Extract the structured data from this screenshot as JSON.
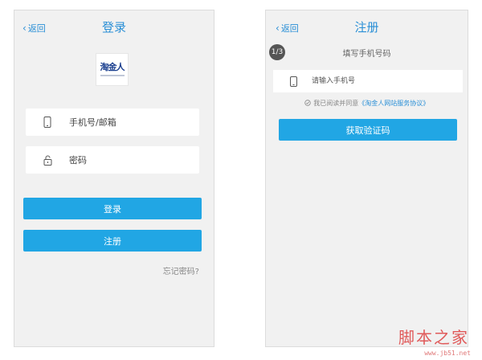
{
  "login": {
    "back_label": "返回",
    "title": "登录",
    "logo_text": "淘金人",
    "account_placeholder": "手机号/邮箱",
    "password_placeholder": "密码",
    "login_button": "登录",
    "register_button": "注册",
    "forgot_password": "忘记密码?"
  },
  "register": {
    "back_label": "返回",
    "title": "注册",
    "step_badge": "1/3",
    "step_title": "填写手机号码",
    "phone_placeholder": "请输入手机号",
    "agree_prefix": "我已阅读并同意",
    "agree_link": "《淘金人网站服务协议》",
    "get_code_button": "获取验证码"
  },
  "watermark": {
    "text": "脚本之家",
    "url": "www.jb51.net"
  },
  "colors": {
    "accent": "#21a6e4",
    "link": "#2a8fd6",
    "panel_bg": "#f1f1f1"
  }
}
